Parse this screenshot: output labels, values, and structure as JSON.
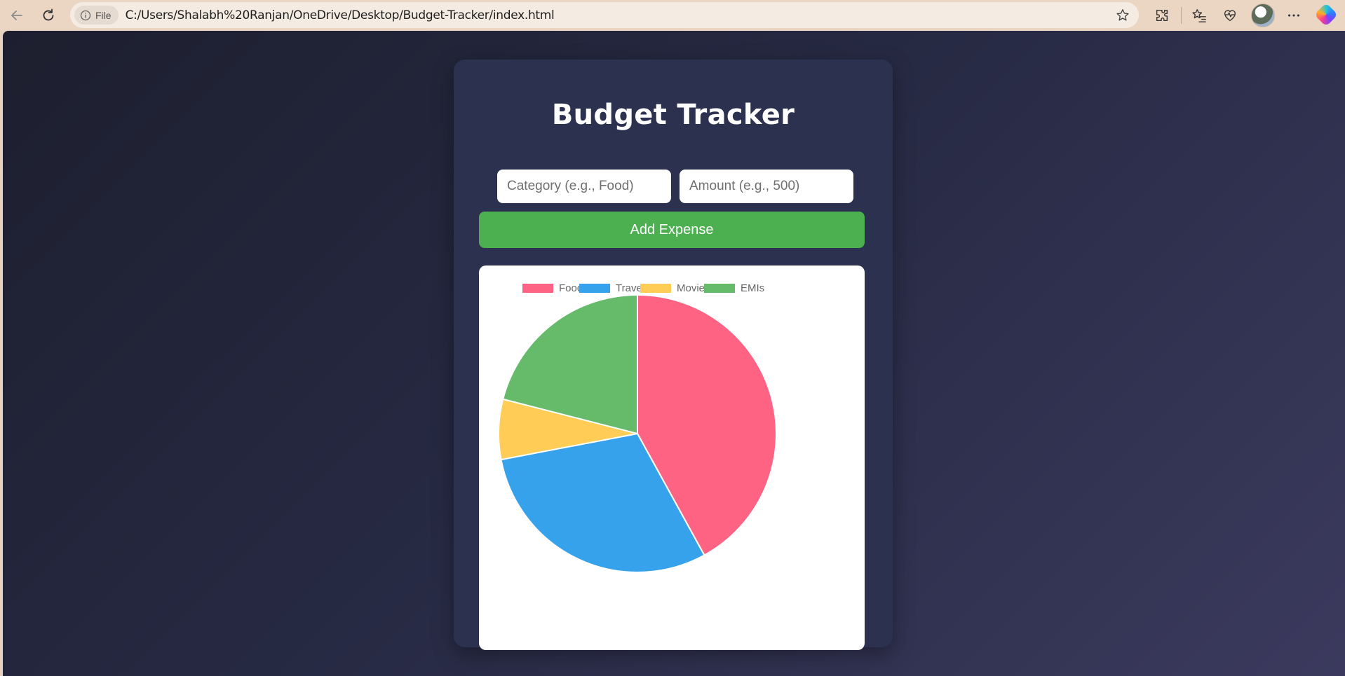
{
  "browser": {
    "file_label": "File",
    "url": "C:/Users/Shalabh%20Ranjan/OneDrive/Desktop/Budget-Tracker/index.html"
  },
  "app": {
    "title": "Budget Tracker",
    "category_placeholder": "Category (e.g., Food)",
    "amount_placeholder": "Amount (e.g., 500)",
    "add_button": "Add Expense"
  },
  "chart_data": {
    "type": "pie",
    "categories": [
      "Food",
      "Travel",
      "Movies",
      "EMIs"
    ],
    "values": [
      42,
      30,
      7,
      21
    ],
    "colors": [
      "#ff6384",
      "#36a2eb",
      "#ffcd56",
      "#66bb6a"
    ],
    "legend_position": "top"
  }
}
